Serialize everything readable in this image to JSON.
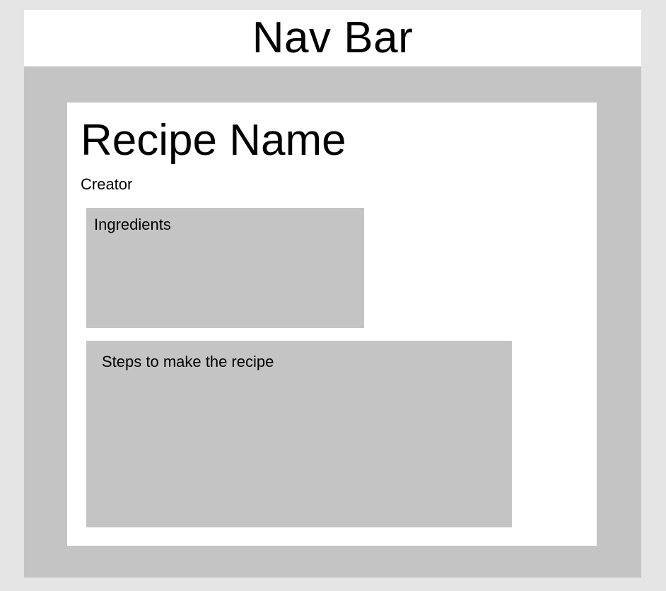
{
  "nav": {
    "title": "Nav Bar"
  },
  "recipe": {
    "name": "Recipe Name",
    "creator": "Creator",
    "ingredients_label": "Ingredients",
    "steps_label": "Steps to make the recipe"
  },
  "colors": {
    "page_background": "#e5e5e5",
    "frame_background": "#c4c4c4",
    "panel_background": "#ffffff",
    "placeholder_box": "#c4c4c4",
    "text": "#000000"
  }
}
